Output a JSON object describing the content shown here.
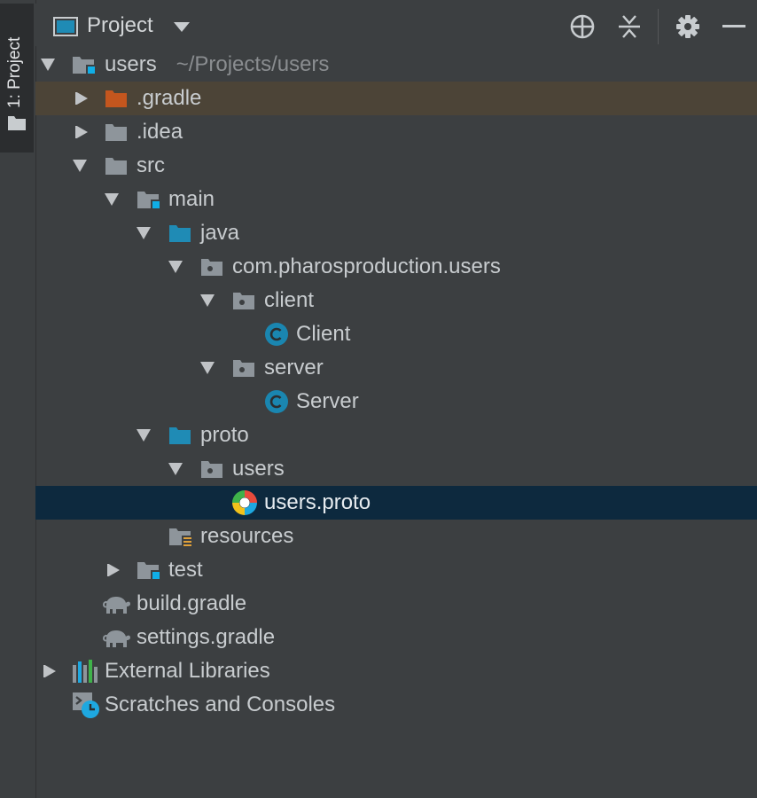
{
  "side_tab": {
    "label": "1: Project"
  },
  "header": {
    "view_name": "Project"
  },
  "tree": [
    {
      "label": "users",
      "path": "~/Projects/users"
    },
    {
      "label": ".gradle"
    },
    {
      "label": ".idea"
    },
    {
      "label": "src"
    },
    {
      "label": "main"
    },
    {
      "label": "java"
    },
    {
      "label": "com.pharosproduction.users"
    },
    {
      "label": "client"
    },
    {
      "label": "Client"
    },
    {
      "label": "server"
    },
    {
      "label": "Server"
    },
    {
      "label": "proto"
    },
    {
      "label": "users"
    },
    {
      "label": "users.proto"
    },
    {
      "label": "resources"
    },
    {
      "label": "test"
    },
    {
      "label": "build.gradle"
    },
    {
      "label": "settings.gradle"
    },
    {
      "label": "External Libraries"
    },
    {
      "label": "Scratches and Consoles"
    }
  ],
  "icons": {
    "locate": "crosshair-icon",
    "collapse": "collapse-all-icon",
    "settings": "gear-icon",
    "hide": "minimize-icon"
  },
  "colors": {
    "selection": "#0d293e",
    "excluded_highlight": "#4c4437",
    "source_folder": "#1f8bb5",
    "class_icon": "#1a86b0",
    "module_badge": "#10aee6",
    "excluded_folder": "#c4561e"
  }
}
